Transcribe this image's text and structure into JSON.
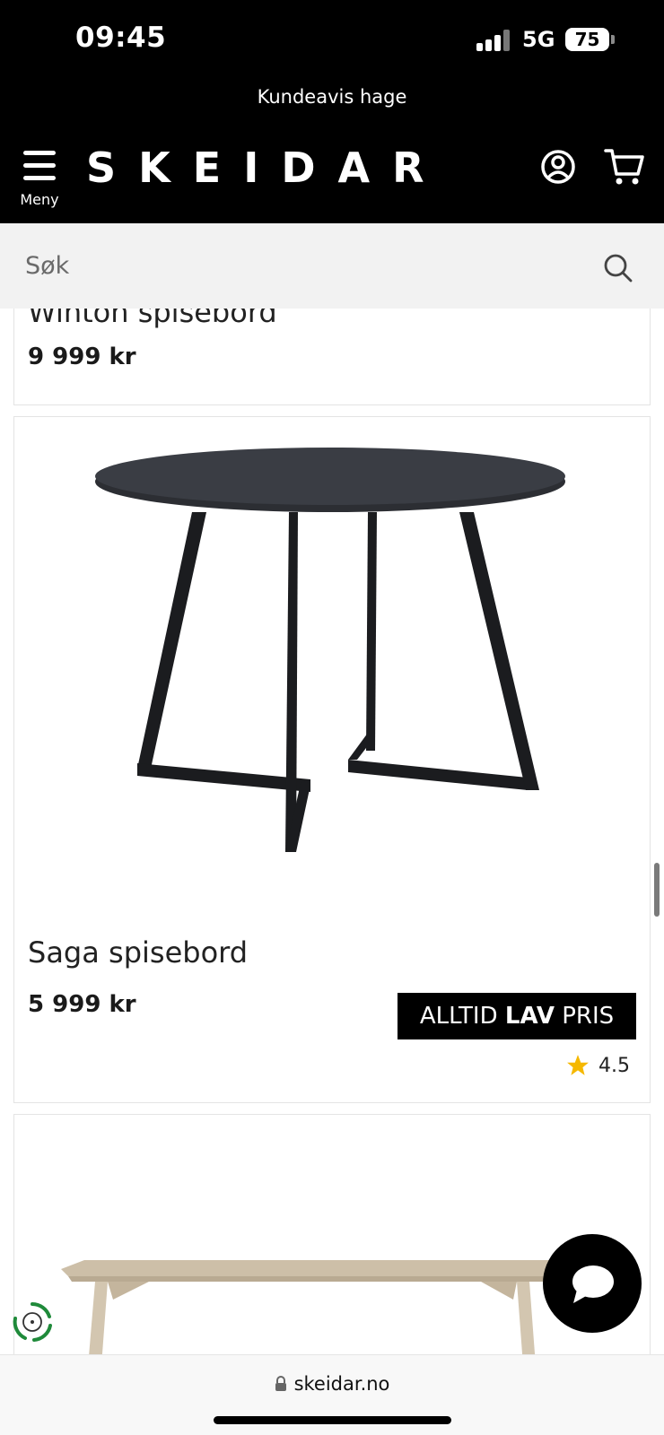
{
  "status_bar": {
    "time": "09:45",
    "network": "5G",
    "battery": "75"
  },
  "header": {
    "promo": "Kundeavis hage",
    "menu_label": "Meny",
    "logo": "SKEIDAR"
  },
  "search": {
    "placeholder": "Søk"
  },
  "products": [
    {
      "name": "Winton spisebord",
      "price": "9 999 kr"
    },
    {
      "name": "Saga spisebord",
      "price": "5 999 kr",
      "badge_prefix": "ALLTID ",
      "badge_bold": "LAV",
      "badge_suffix": " PRIS",
      "rating": "4.5"
    },
    {
      "name": "",
      "price": ""
    }
  ],
  "browser": {
    "url": "skeidar.no"
  },
  "colors": {
    "brand": "#000000",
    "star": "#f5b800",
    "search_bg": "#f2f2f2"
  }
}
